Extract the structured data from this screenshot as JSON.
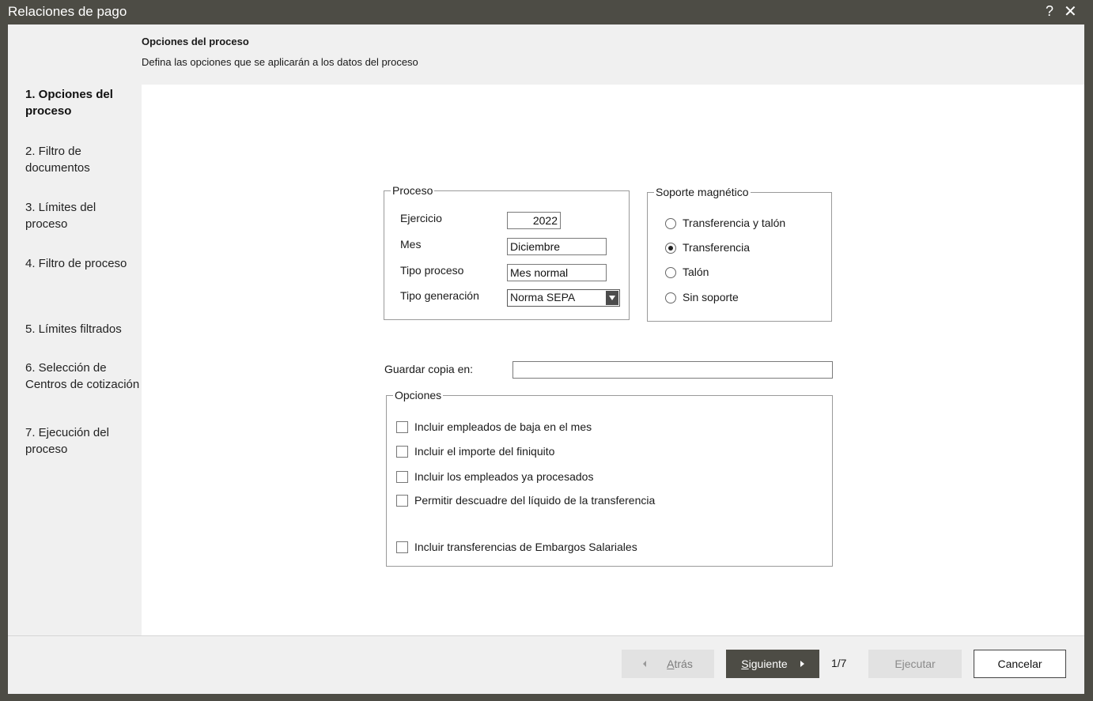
{
  "window": {
    "title": "Relaciones de pago",
    "help_label": "?",
    "close_label": "✕"
  },
  "header": {
    "title": "Opciones del proceso",
    "subtitle": "Defina las opciones que se aplicarán a los datos del proceso"
  },
  "steps": [
    {
      "label": "1. Opciones del proceso",
      "active": true
    },
    {
      "label": "2. Filtro de documentos"
    },
    {
      "label": "3. Límites del proceso"
    },
    {
      "label": "4. Filtro de proceso"
    },
    {
      "label": "5. Límites filtrados"
    },
    {
      "label": "6. Selección de Centros de cotización"
    },
    {
      "label": "7. Ejecución del proceso"
    }
  ],
  "proceso": {
    "legend": "Proceso",
    "ejercicio_label": "Ejercicio",
    "ejercicio_value": "2022",
    "mes_label": "Mes",
    "mes_value": "Diciembre",
    "tipo_proceso_label": "Tipo proceso",
    "tipo_proceso_value": "Mes normal",
    "tipo_generacion_label": "Tipo generación",
    "tipo_generacion_value": "Norma SEPA"
  },
  "soporte": {
    "legend": "Soporte magnético",
    "options": [
      {
        "label": "Transferencia y talón",
        "checked": false
      },
      {
        "label": "Transferencia",
        "checked": true
      },
      {
        "label": "Talón",
        "checked": false
      },
      {
        "label": "Sin soporte",
        "checked": false
      }
    ]
  },
  "guardar": {
    "label": "Guardar copia en:",
    "value": ""
  },
  "opciones": {
    "legend": "Opciones",
    "items": [
      {
        "label": "Incluir empleados de baja en el mes",
        "checked": false
      },
      {
        "label": "Incluir el importe del finiquito",
        "checked": false
      },
      {
        "label": "Incluir los empleados ya procesados",
        "checked": false
      },
      {
        "label": "Permitir descuadre del líquido de la transferencia",
        "checked": false
      },
      {
        "label": "Incluir transferencias de Embargos Salariales",
        "checked": false
      }
    ]
  },
  "footer": {
    "back_accel": "A",
    "back_rest": "trás",
    "next_accel": "S",
    "next_rest": "iguiente",
    "page": "1/7",
    "execute_label": "Ejecutar",
    "cancel_label": "Cancelar"
  }
}
